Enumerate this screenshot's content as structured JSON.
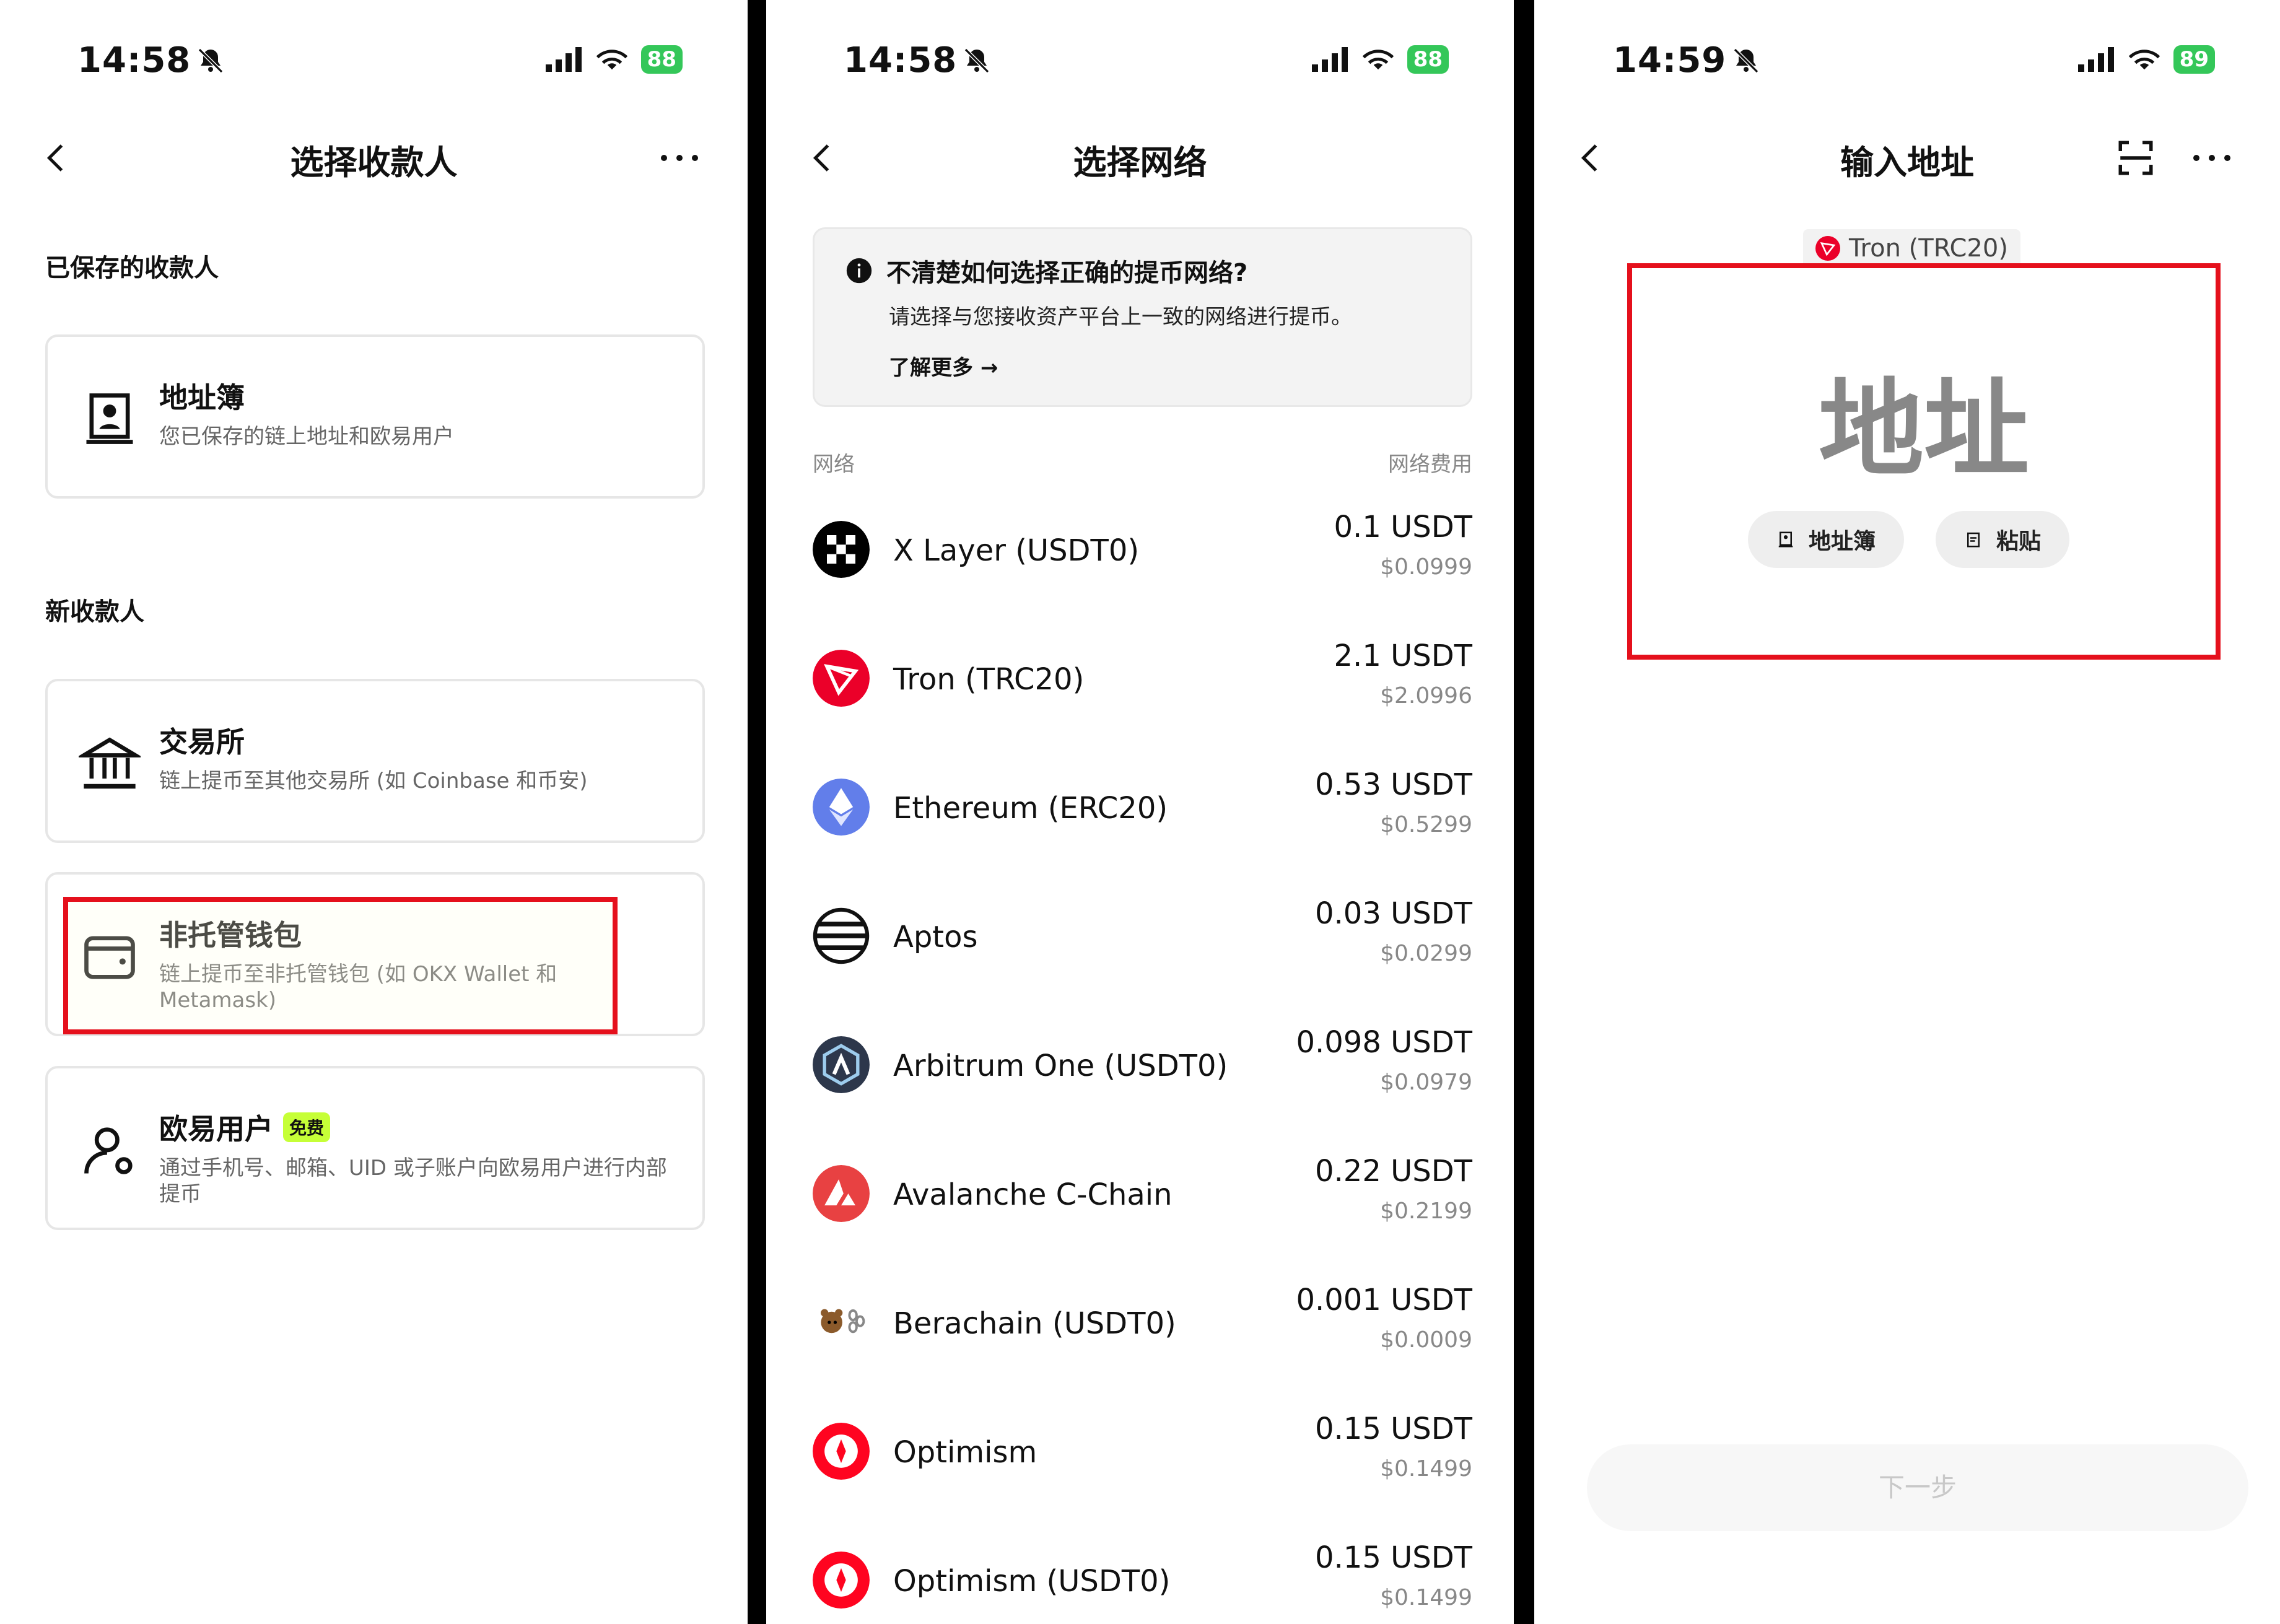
{
  "panel1": {
    "status": {
      "time": "14:58",
      "battery": "88"
    },
    "nav": {
      "title": "选择收款人"
    },
    "saved_label": "已保存的收款人",
    "address_book": {
      "title": "地址簿",
      "sub": "您已保存的链上地址和欧易用户"
    },
    "new_label": "新收款人",
    "exchange": {
      "title": "交易所",
      "sub": "链上提币至其他交易所 (如 Coinbase 和币安)"
    },
    "wallet": {
      "title": "非托管钱包",
      "sub": "链上提币至非托管钱包 (如 OKX Wallet 和 Metamask)"
    },
    "okx_user": {
      "title": "欧易用户",
      "badge": "免费",
      "sub": "通过手机号、邮箱、UID 或子账户向欧易用户进行内部提币"
    }
  },
  "panel2": {
    "status": {
      "time": "14:58",
      "battery": "88"
    },
    "nav": {
      "title": "选择网络"
    },
    "info": {
      "title": "不清楚如何选择正确的提币网络?",
      "desc": "请选择与您接收资产平台上一致的网络进行提币。",
      "link": "了解更多 →"
    },
    "header": {
      "left": "网络",
      "right": "网络费用"
    },
    "networks": [
      {
        "name": "X Layer (USDT0)",
        "fee": "0.1 USDT",
        "usd": "$0.0999",
        "icon": "xlayer-icon"
      },
      {
        "name": "Tron (TRC20)",
        "fee": "2.1 USDT",
        "usd": "$2.0996",
        "icon": "tron-icon"
      },
      {
        "name": "Ethereum (ERC20)",
        "fee": "0.53 USDT",
        "usd": "$0.5299",
        "icon": "ethereum-icon"
      },
      {
        "name": "Aptos",
        "fee": "0.03 USDT",
        "usd": "$0.0299",
        "icon": "aptos-icon"
      },
      {
        "name": "Arbitrum One (USDT0)",
        "fee": "0.098 USDT",
        "usd": "$0.0979",
        "icon": "arbitrum-icon"
      },
      {
        "name": "Avalanche C-Chain",
        "fee": "0.22 USDT",
        "usd": "$0.2199",
        "icon": "avalanche-icon"
      },
      {
        "name": "Berachain (USDT0)",
        "fee": "0.001 USDT",
        "usd": "$0.0009",
        "icon": "berachain-icon"
      },
      {
        "name": "Optimism",
        "fee": "0.15 USDT",
        "usd": "$0.1499",
        "icon": "optimism-icon"
      },
      {
        "name": "Optimism (USDT0)",
        "fee": "0.15 USDT",
        "usd": "$0.1499",
        "icon": "optimism-icon"
      }
    ]
  },
  "panel3": {
    "status": {
      "time": "14:59",
      "battery": "89"
    },
    "nav": {
      "title": "输入地址"
    },
    "network_tag": "Tron (TRC20)",
    "address_placeholder": "地址",
    "address_book_btn": "地址簿",
    "paste_btn": "粘贴",
    "next_btn": "下一步"
  },
  "colors": {
    "highlight": "#e5101c",
    "badge": "#c6ff37",
    "battery": "#34c759",
    "tron": "#eb0029",
    "ethereum": "#627eea",
    "avalanche": "#e84142",
    "arbitrum": "#2d374b",
    "optimism": "#ff0420"
  }
}
